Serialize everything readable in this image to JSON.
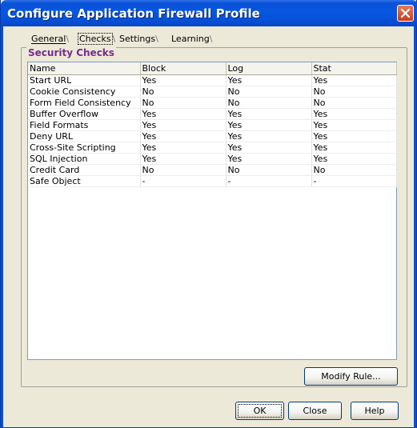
{
  "window": {
    "title": "Configure Application Firewall Profile"
  },
  "tabs": [
    {
      "label": "General",
      "selected": false
    },
    {
      "label": "Checks",
      "selected": true
    },
    {
      "label": "Settings",
      "selected": false
    },
    {
      "label": "Learning",
      "selected": false
    }
  ],
  "security_checks": {
    "group_title": "Security Checks",
    "columns": [
      "Name",
      "Block",
      "Log",
      "Stat"
    ],
    "rows": [
      [
        "Start URL",
        "Yes",
        "Yes",
        "Yes"
      ],
      [
        "Cookie Consistency",
        "No",
        "No",
        "No"
      ],
      [
        "Form Field Consistency",
        "No",
        "No",
        "No"
      ],
      [
        "Buffer Overflow",
        "Yes",
        "Yes",
        "Yes"
      ],
      [
        "Field Formats",
        "Yes",
        "Yes",
        "Yes"
      ],
      [
        "Deny URL",
        "Yes",
        "Yes",
        "Yes"
      ],
      [
        "Cross-Site Scripting",
        "Yes",
        "Yes",
        "Yes"
      ],
      [
        "SQL Injection",
        "Yes",
        "Yes",
        "Yes"
      ],
      [
        "Credit Card",
        "No",
        "No",
        "No"
      ],
      [
        "Safe Object",
        "-",
        "-",
        "-"
      ]
    ]
  },
  "buttons": {
    "modify_rule": "Modify Rule...",
    "ok": "OK",
    "close": "Close",
    "help": "Help"
  },
  "colors": {
    "title_bar": "#0757e0",
    "group_title": "#7a2b8c",
    "dialog_bg": "#ece9d8"
  }
}
